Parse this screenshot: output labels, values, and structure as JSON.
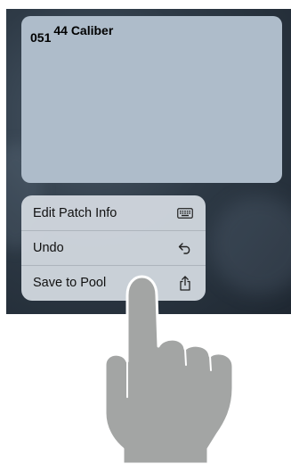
{
  "patch": {
    "number": "051",
    "name": "44 Caliber"
  },
  "menu": {
    "items": [
      {
        "label": "Edit Patch Info",
        "icon": "keyboard-icon"
      },
      {
        "label": "Undo",
        "icon": "undo-arrow-icon"
      },
      {
        "label": "Save to Pool",
        "icon": "share-icon"
      }
    ]
  },
  "colors": {
    "card": "#aebcca",
    "menu": "#d0d6de",
    "hand": "#a3a5a4",
    "background": "#2e3a46"
  },
  "icons": {
    "hand": "pointing-hand-icon"
  }
}
